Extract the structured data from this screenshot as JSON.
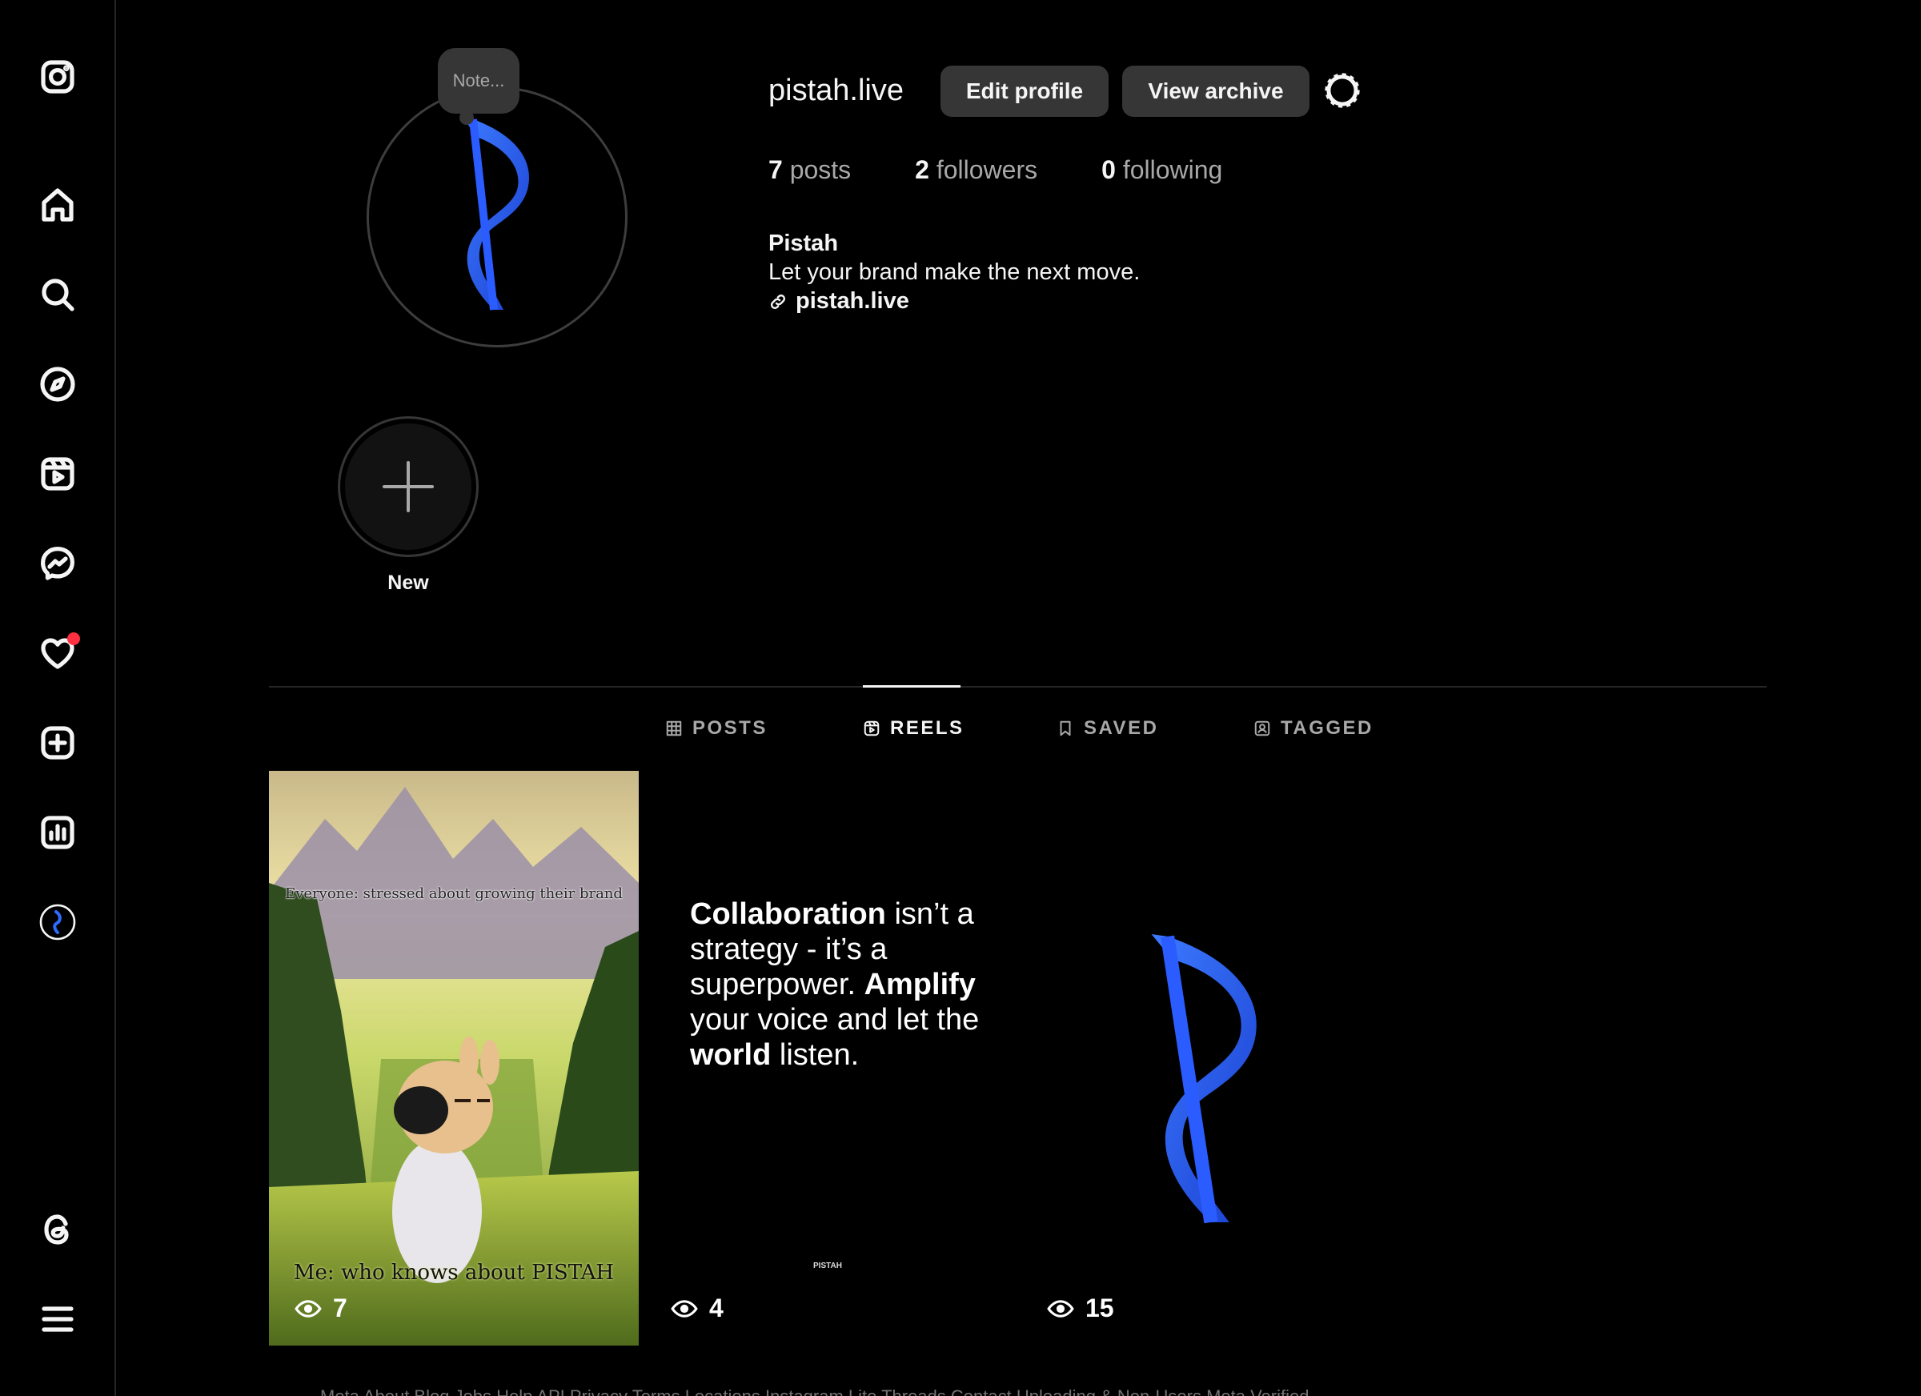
{
  "sidebar": {
    "items": [
      {
        "name": "instagram-logo-icon"
      },
      {
        "name": "home-icon"
      },
      {
        "name": "search-icon"
      },
      {
        "name": "explore-icon"
      },
      {
        "name": "reels-icon"
      },
      {
        "name": "messenger-icon"
      },
      {
        "name": "notifications-heart-icon",
        "has_dot": true
      },
      {
        "name": "create-icon"
      },
      {
        "name": "insights-icon"
      },
      {
        "name": "profile-avatar-icon"
      },
      {
        "name": "threads-icon"
      },
      {
        "name": "menu-icon"
      }
    ]
  },
  "profile": {
    "note_placeholder": "Note...",
    "username": "pistah.live",
    "edit_profile_label": "Edit profile",
    "view_archive_label": "View archive",
    "stats": {
      "posts_count": "7",
      "posts_label": " posts",
      "followers_count": "2",
      "followers_label": " followers",
      "following_count": "0",
      "following_label": " following"
    },
    "full_name": "Pistah",
    "bio": "Let your brand make the next move.",
    "link": "pistah.live"
  },
  "highlights": {
    "new_label": "New"
  },
  "tabs": [
    {
      "label": "POSTS",
      "active": false
    },
    {
      "label": "REELS",
      "active": true
    },
    {
      "label": "SAVED",
      "active": false
    },
    {
      "label": "TAGGED",
      "active": false
    }
  ],
  "reels": [
    {
      "views": "7",
      "caption_top": "Everyone: stressed about growing their brand",
      "caption_bottom": "Me: who knows about PISTAH"
    },
    {
      "views": "4",
      "quote_parts": [
        "Collaboration",
        " isn’t a strategy - it’s a superpower. ",
        "Amplify",
        " your voice and let the ",
        "world",
        " listen."
      ],
      "brand_mark": "PISTAH"
    },
    {
      "views": "15"
    }
  ],
  "footer": {
    "text": "Meta   About   Blog   Jobs   Help   API   Privacy   Terms   Locations   Instagram Lite   Threads   Contact Uploading & Non-Users   Meta Verified"
  },
  "colors": {
    "background": "#000000",
    "button_bg": "#363636",
    "brand_blue": "#2f6bff",
    "notification_red": "#ff3040",
    "muted_text": "#a8a8a8"
  }
}
